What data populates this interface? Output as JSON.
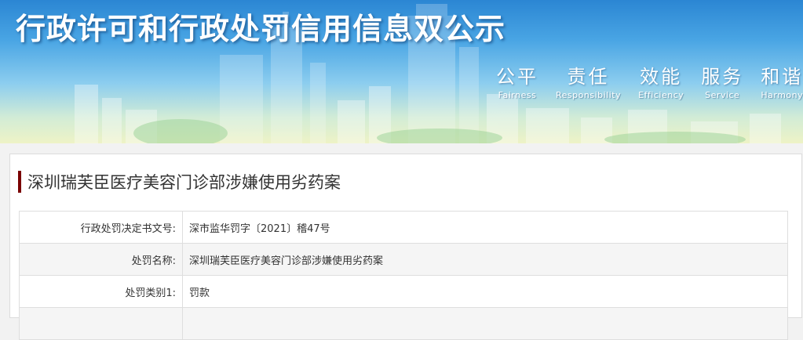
{
  "banner": {
    "title": "行政许可和行政处罚信用信息双公示",
    "slogans": [
      {
        "cn": "公平",
        "en": "Fairness"
      },
      {
        "cn": "责任",
        "en": "Responsibility"
      },
      {
        "cn": "效能",
        "en": "Efficiency"
      },
      {
        "cn": "服务",
        "en": "Service"
      },
      {
        "cn": "和谐",
        "en": "Harmony"
      }
    ]
  },
  "case": {
    "title": "深圳瑞芙臣医疗美容门诊部涉嫌使用劣药案",
    "rows": [
      {
        "label": "行政处罚决定书文号:",
        "value": "深市监华罚字〔2021〕稽47号"
      },
      {
        "label": "处罚名称:",
        "value": "深圳瑞芙臣医疗美容门诊部涉嫌使用劣药案"
      },
      {
        "label": "处罚类别1:",
        "value": "罚款"
      },
      {
        "label": "",
        "value": ""
      }
    ]
  },
  "colors": {
    "title_marker": "#7a0000",
    "banner_sky": "#49a5e4",
    "page_background": "#f2f2f2"
  }
}
